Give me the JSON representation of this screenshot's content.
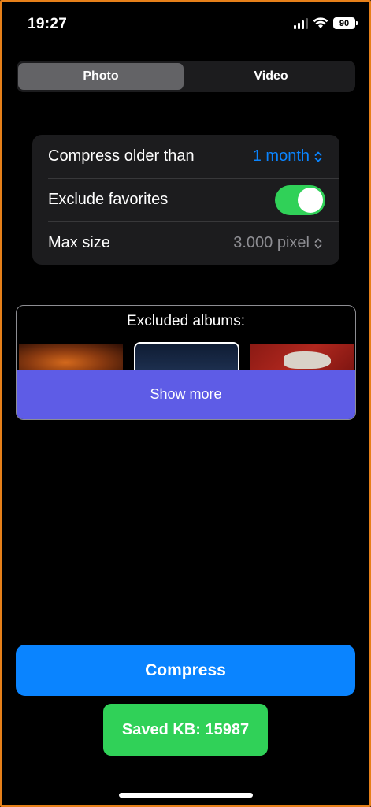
{
  "status_bar": {
    "time": "19:27",
    "battery": "90",
    "icons": [
      "signal-icon",
      "wifi-icon",
      "battery-icon"
    ]
  },
  "segmented": {
    "tabs": [
      {
        "label": "Photo",
        "selected": true
      },
      {
        "label": "Video",
        "selected": false
      }
    ]
  },
  "settings": {
    "compress_older": {
      "label": "Compress older than",
      "value": "1 month"
    },
    "exclude_favorites": {
      "label": "Exclude favorites",
      "on": true
    },
    "max_size": {
      "label": "Max size",
      "value": "3.000 pixel"
    }
  },
  "albums": {
    "title": "Excluded albums:",
    "show_more": "Show more"
  },
  "actions": {
    "compress": "Compress",
    "saved": "Saved KB: 15987"
  },
  "colors": {
    "accent_blue": "#0a84ff",
    "toggle_green": "#30d158",
    "show_more_purple": "#5e5ce6"
  }
}
